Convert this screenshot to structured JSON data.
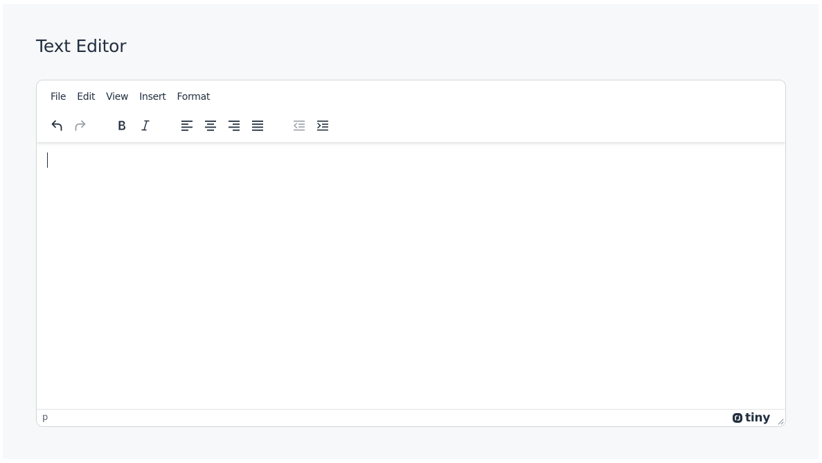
{
  "page": {
    "title": "Text Editor"
  },
  "menubar": {
    "items": [
      "File",
      "Edit",
      "View",
      "Insert",
      "Format"
    ]
  },
  "toolbar": {
    "groups": [
      [
        "undo-icon",
        "redo-icon"
      ],
      [
        "bold-icon",
        "italic-icon"
      ],
      [
        "align-left-icon",
        "align-center-icon",
        "align-right-icon",
        "align-justify-icon"
      ],
      [
        "outdent-icon",
        "indent-icon"
      ]
    ],
    "disabled": [
      "redo-icon",
      "outdent-icon"
    ]
  },
  "statusbar": {
    "path": "p",
    "brand": "tiny"
  },
  "colors": {
    "text": "#222f3e",
    "page_bg": "#f7f8fa",
    "border": "#d3d5d8"
  }
}
